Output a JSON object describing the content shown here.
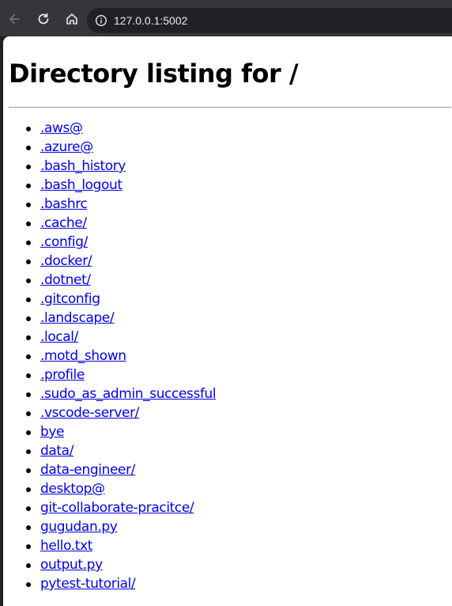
{
  "browser": {
    "url": "127.0.0.1:5002"
  },
  "page": {
    "heading": "Directory listing for /",
    "entries": [
      ".aws@",
      ".azure@",
      ".bash_history",
      ".bash_logout",
      ".bashrc",
      ".cache/",
      ".config/",
      ".docker/",
      ".dotnet/",
      ".gitconfig",
      ".landscape/",
      ".local/",
      ".motd_shown",
      ".profile",
      ".sudo_as_admin_successful",
      ".vscode-server/",
      "bye",
      "data/",
      "data-engineer/",
      "desktop@",
      "git-collaborate-pracitce/",
      "gugudan.py",
      "hello.txt",
      "output.py",
      "pytest-tutorial/"
    ]
  }
}
